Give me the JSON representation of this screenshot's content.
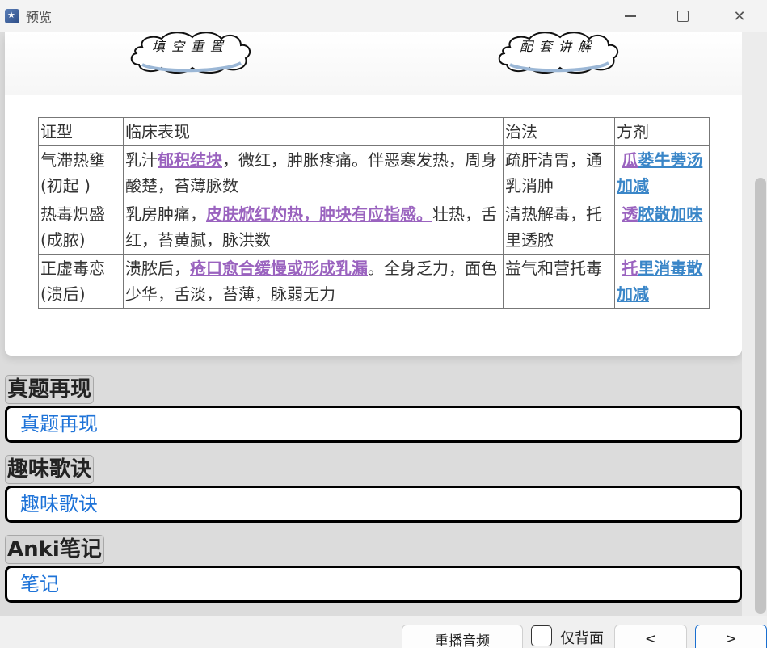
{
  "window": {
    "title": "预览"
  },
  "banner": {
    "left_cloud": "填空重置",
    "right_cloud": "配套讲解"
  },
  "table": {
    "headers": [
      "证型",
      "临床表现",
      "治法",
      "方剂"
    ],
    "rows": [
      {
        "type": "气滞热壅(初起 )",
        "symptom_pre": "乳汁",
        "symptom_key": "郁积结块",
        "symptom_post": "，微红，肿胀疼痛。伴恶寒发热，周身酸楚，苔薄脉数",
        "method": "疏肝清胃，通乳消肿",
        "rx_a": "瓜",
        "rx_b": "蒌牛蒡汤加减"
      },
      {
        "type": "热毒炽盛(成脓)",
        "symptom_pre": "乳房肿痛，",
        "symptom_key": "皮肤焮红灼热，肿块有应指感。",
        "symptom_post": "壮热，舌红，苔黄腻，脉洪数",
        "method": "清热解毒，托里透脓",
        "rx_a": "透",
        "rx_b": "脓散加味"
      },
      {
        "type": "正虚毒恋(溃后)",
        "symptom_pre": "溃脓后，",
        "symptom_key": "疮口愈合缓慢或形成乳漏",
        "symptom_post": "。全身乏力，面色少华，舌淡，苔薄，脉弱无力",
        "method": "益气和营托毒",
        "rx_a": "托",
        "rx_b": "里消毒散加减"
      }
    ]
  },
  "sections": [
    {
      "title": "真题再现",
      "content": "真题再现"
    },
    {
      "title": "趣味歌诀",
      "content": "趣味歌诀"
    },
    {
      "title": "Anki笔记",
      "content": "笔记"
    }
  ],
  "bottom": {
    "replay_label": "重播音频",
    "back_only_label": "仅背面",
    "prev_label": "<",
    "next_label": ">"
  },
  "colors": {
    "keyword": "#9a63bf",
    "formula": "#3a86c8",
    "link": "#1e73d8"
  }
}
